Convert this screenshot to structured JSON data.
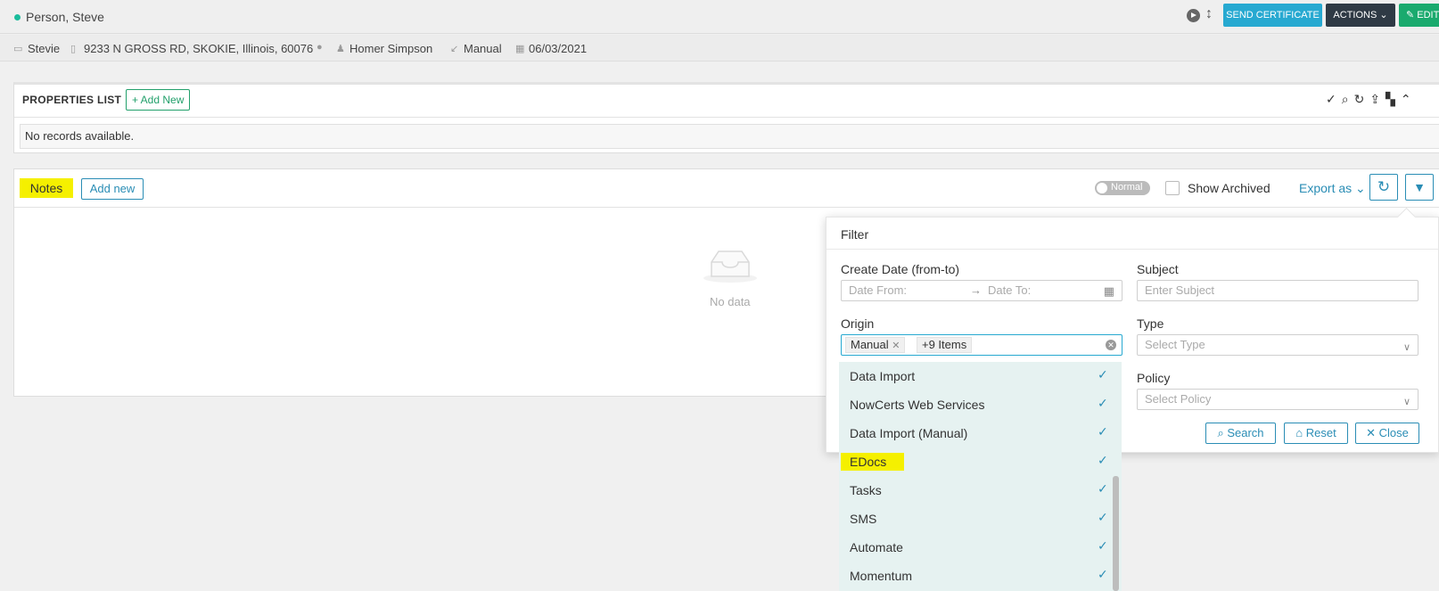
{
  "header": {
    "person_name": "Person, Steve",
    "send_certificate": "SEND CERTIFICATE",
    "actions": "ACTIONS",
    "edit": "EDIT"
  },
  "info": {
    "nickname": "Stevie",
    "address": "9233 N GROSS RD, SKOKIE, Illinois, 60076",
    "agent": "Homer Simpson",
    "source": "Manual",
    "date": "06/03/2021"
  },
  "properties": {
    "title": "PROPERTIES LIST",
    "add_new": "+ Add New",
    "no_records": "No records available."
  },
  "notes": {
    "title": "Notes",
    "add_new": "Add new",
    "toggle_label": "Normal",
    "show_archived": "Show Archived",
    "export_as": "Export as",
    "empty": "No data"
  },
  "filter": {
    "title": "Filter",
    "create_date_label": "Create Date (from-to)",
    "date_from_placeholder": "Date From:",
    "date_to_placeholder": "Date To:",
    "subject_label": "Subject",
    "subject_placeholder": "Enter Subject",
    "origin_label": "Origin",
    "origin_tag": "Manual",
    "origin_more": "+9 Items",
    "type_label": "Type",
    "type_placeholder": "Select Type",
    "policy_label": "Policy",
    "policy_placeholder": "Select Policy",
    "search": "Search",
    "reset": "Reset",
    "close": "Close"
  },
  "origin_options": [
    {
      "label": "Data Import",
      "checked": true
    },
    {
      "label": "NowCerts Web Services",
      "checked": true
    },
    {
      "label": "Data Import (Manual)",
      "checked": true
    },
    {
      "label": "EDocs",
      "checked": true,
      "highlighted": true
    },
    {
      "label": "Tasks",
      "checked": true
    },
    {
      "label": "SMS",
      "checked": true
    },
    {
      "label": "Automate",
      "checked": true
    },
    {
      "label": "Momentum",
      "checked": true
    }
  ],
  "colors": {
    "accent": "#2a8db5",
    "send_certificate": "#27a9d1",
    "actions": "#2f3a45",
    "edit": "#1aaa6e",
    "highlight": "#f5f000",
    "dropdown_bg": "#e6f2f1"
  }
}
